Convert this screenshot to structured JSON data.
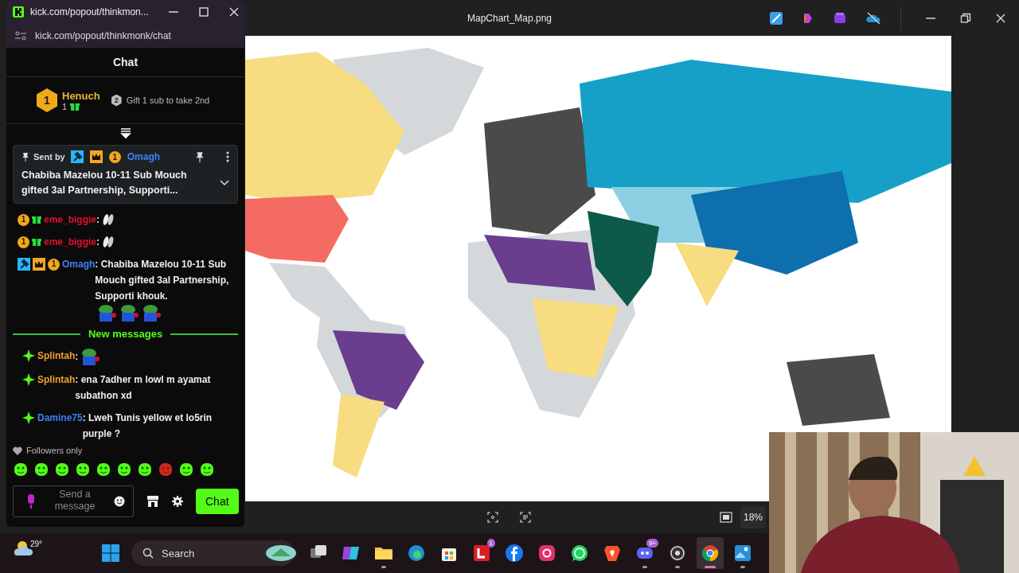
{
  "viewer": {
    "title": "MapChart_Map.png",
    "zoom": "18%"
  },
  "chat_window": {
    "tab_title": "kick.com/popout/thinkmon...",
    "url": "kick.com/popout/thinkmonk/chat",
    "header": "Chat",
    "leaderboard": {
      "rank": "1",
      "name": "Henuch",
      "count": "1",
      "next_rank": "2",
      "next_text": "Gift 1 sub to take 2nd"
    },
    "pinned": {
      "sent_by": "Sent by",
      "badges": [
        {
          "kind": "mod"
        },
        {
          "kind": "crown"
        },
        {
          "kind": "rank",
          "text": "1"
        }
      ],
      "user": "Omagh",
      "color": "#3b82f6",
      "text": "Chabiba Mazelou 10-11 Sub Mouch gifted 3al Partnership, Supporti..."
    },
    "messages": [
      {
        "kind": "message",
        "badges": [
          {
            "kind": "rank",
            "text": "1"
          },
          {
            "kind": "gift"
          }
        ],
        "user": "eme_biggie",
        "color": "#e0102a",
        "text": ":",
        "emotes": [
          {
            "kind": "clap"
          }
        ]
      },
      {
        "kind": "message",
        "badges": [
          {
            "kind": "rank",
            "text": "1"
          },
          {
            "kind": "gift"
          }
        ],
        "user": "eme_biggie",
        "color": "#e0102a",
        "text": ":",
        "emotes": [
          {
            "kind": "clap"
          }
        ]
      },
      {
        "kind": "message",
        "badges": [
          {
            "kind": "mod"
          },
          {
            "kind": "crown"
          },
          {
            "kind": "rank",
            "text": "1"
          }
        ],
        "user": "Omagh",
        "color": "#3b82f6",
        "text": ": Chabiba Mazelou 10-11 Sub Mouch gifted 3al Partnership, Supporti khouk.",
        "emotes": [
          {
            "kind": "frog"
          },
          {
            "kind": "frog"
          },
          {
            "kind": "frog"
          }
        ]
      },
      {
        "kind": "divider",
        "text": "New messages"
      },
      {
        "kind": "message",
        "badges": [
          {
            "kind": "sparkle"
          }
        ],
        "user": "Splintah",
        "color": "#f0a030",
        "text": ":",
        "emotes": [
          {
            "kind": "frog"
          }
        ]
      },
      {
        "kind": "message",
        "badges": [
          {
            "kind": "sparkle"
          }
        ],
        "user": "Splintah",
        "color": "#f0a030",
        "text": ": ena 7adher m lowl m ayamat subathon xd"
      },
      {
        "kind": "message",
        "badges": [
          {
            "kind": "sparkle"
          }
        ],
        "user": "Damine75",
        "color": "#3b82f6",
        "text": ": Lweh Tunis yellow et lo5rin purple ?"
      }
    ],
    "followers_only": "Followers only",
    "input": {
      "placeholder": "Send a message"
    },
    "send_button": "Chat"
  },
  "taskbar": {
    "weather": "29°",
    "search": {
      "placeholder": "Search"
    },
    "apps": [
      {
        "kind": "taskview",
        "running": false,
        "selected": false
      },
      {
        "kind": "m365",
        "running": false,
        "selected": false
      },
      {
        "kind": "folder",
        "running": true,
        "selected": false
      },
      {
        "kind": "edge",
        "running": false,
        "selected": false
      },
      {
        "kind": "store",
        "running": false,
        "selected": false
      },
      {
        "kind": "letter-app",
        "running": false,
        "selected": false,
        "badge": "1"
      },
      {
        "kind": "facebook",
        "running": false,
        "selected": false
      },
      {
        "kind": "instagram",
        "running": false,
        "selected": false
      },
      {
        "kind": "whatsapp",
        "running": false,
        "selected": false
      },
      {
        "kind": "brave",
        "running": false,
        "selected": false
      },
      {
        "kind": "discord",
        "running": true,
        "selected": false,
        "badge": "9+"
      },
      {
        "kind": "obs",
        "running": true,
        "selected": false
      },
      {
        "kind": "chrome",
        "running": true,
        "selected": true
      },
      {
        "kind": "photos",
        "running": true,
        "selected": false
      }
    ]
  }
}
